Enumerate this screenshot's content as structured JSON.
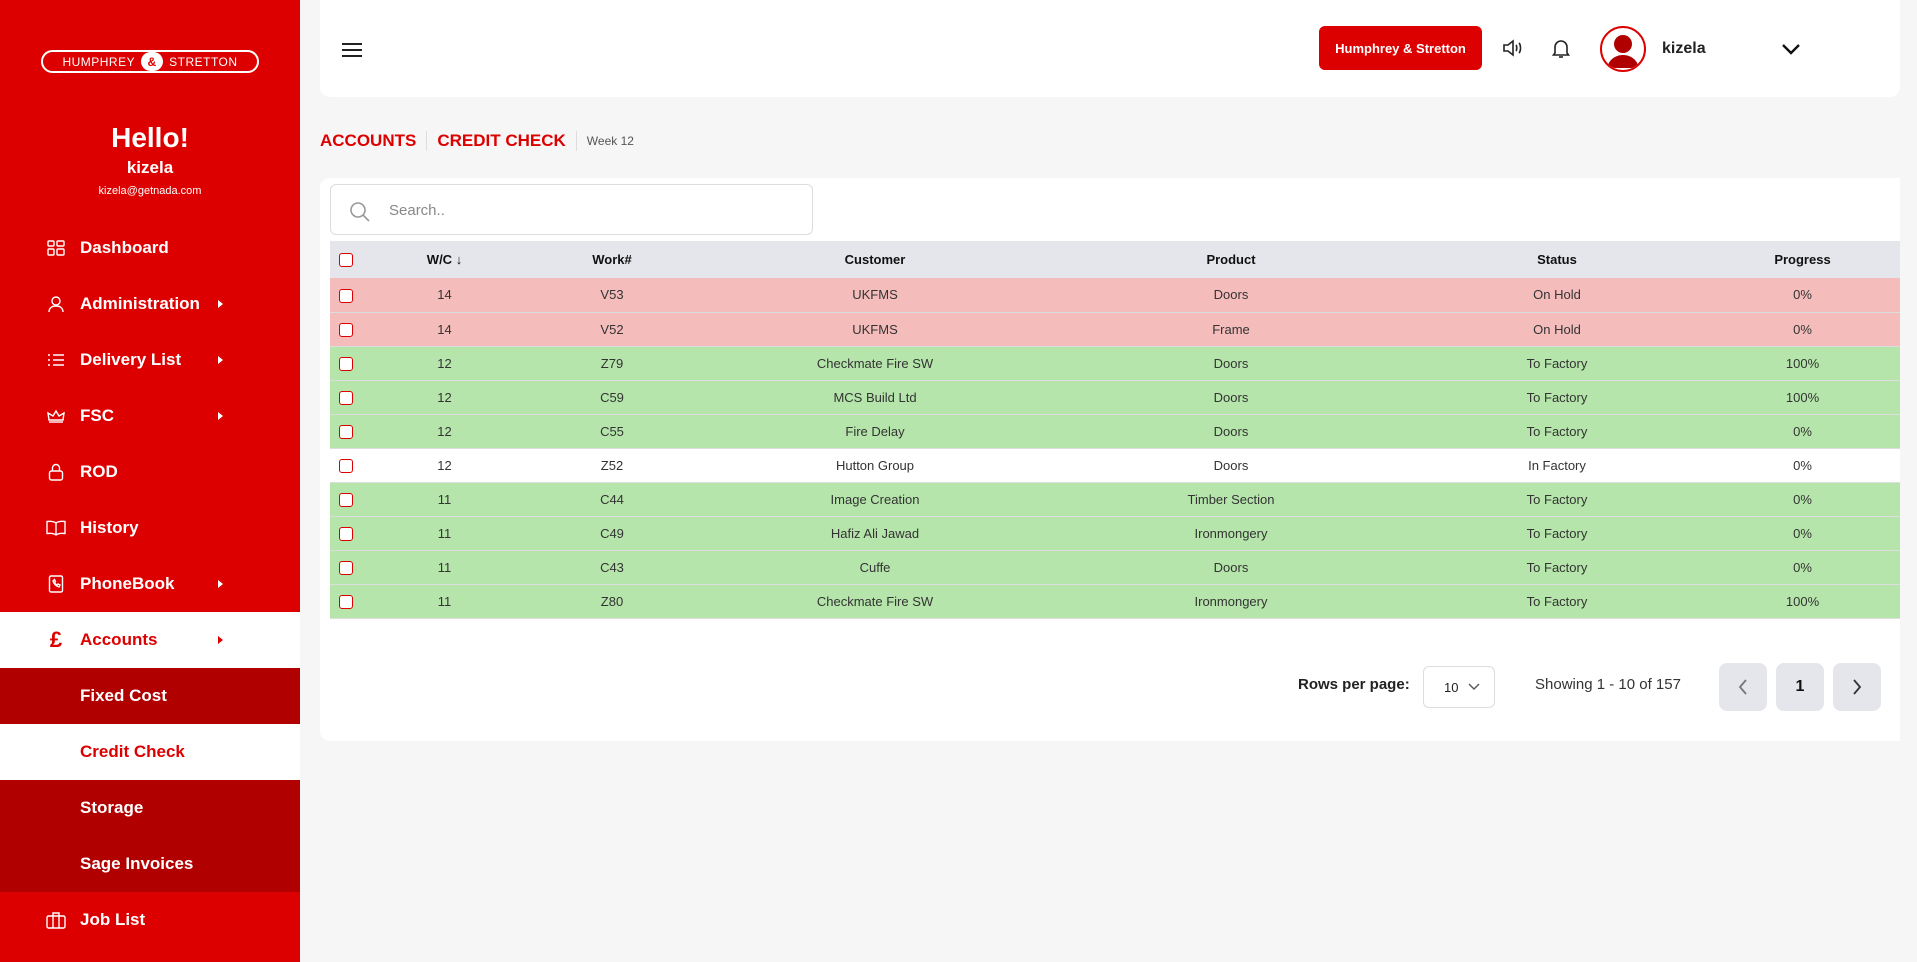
{
  "brand": {
    "left": "HUMPHREY",
    "amp": "&",
    "right": "STRETTON"
  },
  "greeting": {
    "hello": "Hello!",
    "name": "kizela",
    "email": "kizela@getnada.com"
  },
  "sidebar": {
    "items": [
      {
        "label": "Dashboard",
        "icon": "dashboard-icon"
      },
      {
        "label": "Administration",
        "icon": "user-icon"
      },
      {
        "label": "Delivery List",
        "icon": "list-icon"
      },
      {
        "label": "FSC",
        "icon": "crown-icon"
      },
      {
        "label": "ROD",
        "icon": "lock-icon"
      },
      {
        "label": "History",
        "icon": "book-icon"
      },
      {
        "label": "PhoneBook",
        "icon": "phonebook-icon"
      },
      {
        "label": "Accounts",
        "icon": "pound-icon"
      },
      {
        "label": "Job List",
        "icon": "briefcase-icon"
      }
    ],
    "accounts_sub": [
      "Fixed Cost",
      "Credit Check",
      "Storage",
      "Sage Invoices"
    ]
  },
  "topbar": {
    "company_button": "Humphrey & Stretton",
    "username": "kizela"
  },
  "breadcrumb": {
    "section": "ACCOUNTS",
    "page": "CREDIT CHECK",
    "week": "Week 12"
  },
  "search": {
    "placeholder": "Search.."
  },
  "table": {
    "columns": [
      "W/C",
      "Work#",
      "Customer",
      "Product",
      "Status",
      "Progress"
    ],
    "sort_arrow": "↓",
    "rows": [
      {
        "wc": "14",
        "work": "V53",
        "customer": "UKFMS",
        "product": "Doors",
        "status": "On Hold",
        "progress": "0%",
        "state": "hold"
      },
      {
        "wc": "14",
        "work": "V52",
        "customer": "UKFMS",
        "product": "Frame",
        "status": "On Hold",
        "progress": "0%",
        "state": "hold"
      },
      {
        "wc": "12",
        "work": "Z79",
        "customer": "Checkmate Fire SW",
        "product": "Doors",
        "status": "To Factory",
        "progress": "100%",
        "state": "tofac"
      },
      {
        "wc": "12",
        "work": "C59",
        "customer": "MCS Build Ltd",
        "product": "Doors",
        "status": "To Factory",
        "progress": "100%",
        "state": "tofac"
      },
      {
        "wc": "12",
        "work": "C55",
        "customer": "Fire Delay",
        "product": "Doors",
        "status": "To Factory",
        "progress": "0%",
        "state": "tofac"
      },
      {
        "wc": "12",
        "work": "Z52",
        "customer": "Hutton Group",
        "product": "Doors",
        "status": "In Factory",
        "progress": "0%",
        "state": "infac"
      },
      {
        "wc": "11",
        "work": "C44",
        "customer": "Image Creation",
        "product": "Timber Section",
        "status": "To Factory",
        "progress": "0%",
        "state": "tofac"
      },
      {
        "wc": "11",
        "work": "C49",
        "customer": "Hafiz Ali Jawad",
        "product": "Ironmongery",
        "status": "To Factory",
        "progress": "0%",
        "state": "tofac"
      },
      {
        "wc": "11",
        "work": "C43",
        "customer": "Cuffe",
        "product": "Doors",
        "status": "To Factory",
        "progress": "0%",
        "state": "tofac"
      },
      {
        "wc": "11",
        "work": "Z80",
        "customer": "Checkmate Fire SW",
        "product": "Ironmongery",
        "status": "To Factory",
        "progress": "100%",
        "state": "tofac"
      }
    ]
  },
  "pagination": {
    "rows_label": "Rows per page:",
    "rows_value": "10",
    "showing": "Showing 1 - 10 of 157",
    "page": "1"
  },
  "colors": {
    "brand_red": "#dd0000",
    "hold_row": "#f5bcbc",
    "factory_row": "#b5e5aa",
    "submenu": "#b00000"
  }
}
